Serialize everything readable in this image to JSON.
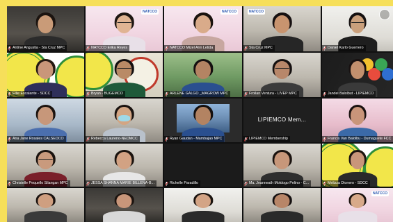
{
  "participants": [
    {
      "name": "Antine Angustia - Sta Cruz MPC",
      "scene": "office-dark",
      "skin": "#c99b78",
      "hair": "#1b1410",
      "shirt": "#2b2b2b"
    },
    {
      "name": "NATCCO Erika Reyes",
      "scene": "natcco-pink",
      "skin": "#e0b493",
      "hair": "#1e1612",
      "shirt": "#e8e0e8",
      "glasses": true
    },
    {
      "name": "NATCCO Mizel Ann Letida",
      "scene": "natcco-pink",
      "skin": "#d9ab8a",
      "hair": "#1a120e",
      "shirt": "#c7a7a0"
    },
    {
      "name": "Sta Cruz MPC",
      "scene": "office-light",
      "skin": "#c8946f",
      "hair": "#161010",
      "shirt": "#262626",
      "logo": "NATCCO"
    },
    {
      "name": "Daniel Karlo Guerrero",
      "scene": "office-white",
      "skin": "#caa07c",
      "hair": "#141010",
      "shirt": "#1e1e1e",
      "glasses": true
    },
    {
      "name": "Ellie Escalante - SDCC",
      "scene": "seal-bg",
      "skin": "#c9967a",
      "hair": "#241812",
      "shirt": "#2f2f5a"
    },
    {
      "name": "Bryan - BUGEMCO",
      "scene": "green-logo",
      "skin": "#b98a66",
      "hair": "#131010",
      "shirt": "#1f5a3a",
      "glasses": true
    },
    {
      "name": "ARLENE GALGO _MAGROW MPC",
      "scene": "outdoor",
      "skin": "#b48463",
      "hair": "#141010",
      "shirt": "#2a4f8f"
    },
    {
      "name": "Froilan Ventura - LIVEP MPC",
      "scene": "office-light",
      "skin": "#b8876a",
      "hair": "#151010",
      "shirt": "#3b3b3b",
      "glasses": true
    },
    {
      "name": "Jandel Balolbut - LIPIEMCO",
      "scene": "colorful",
      "skin": "#c2906e",
      "hair": "#171111",
      "shirt": "#3a3a3a"
    },
    {
      "name": "Ana Jane Rosales CALSEDCO",
      "scene": "office-blue",
      "skin": "#c7977a",
      "hair": "#1b130f",
      "shirt": "#4b6fae"
    },
    {
      "name": "Rebecca Laureno-NEDMCC",
      "scene": "office-light",
      "skin": "#d3a583",
      "hair": "#1a1310",
      "shirt": "#b9c1cb",
      "mask": true
    },
    {
      "name": "Ryan Gaudan - Mambajao MPC",
      "scene": "group-photo",
      "skin": "#b38362",
      "hair": "#141010",
      "shirt": "#2a4f8f"
    },
    {
      "name": "LIPIEMCO Membership",
      "scene": "name-only",
      "label": "LIPIEMCO  Mem..."
    },
    {
      "name": "Francis Van Balolbu - Dumaguete FCC",
      "scene": "pink-room",
      "skin": "#c9957a",
      "hair": "#1a1210",
      "shirt": "#3b6aa8"
    },
    {
      "name": "Christelle Pequello Silangan MPC",
      "scene": "office-light",
      "skin": "#c99a7d",
      "hair": "#1a130f",
      "shirt": "#7a1f2a",
      "glasses": true
    },
    {
      "name": "JESSA SHANNA MARIE BILLENA-B...",
      "scene": "office-light",
      "skin": "#d2a283",
      "hair": "#1b140f",
      "shirt": "#e7e7e7"
    },
    {
      "name": "Richelle Paradillo",
      "scene": "dark",
      "skin": "",
      "hair": "",
      "shirt": ""
    },
    {
      "name": "Ma. Jeanneath Moldogo Pelino - C...",
      "scene": "office-light",
      "skin": "#c7977a",
      "hair": "#1a130f",
      "shirt": "#2e2e2e"
    },
    {
      "name": "Melizza Dionero - SDCC",
      "scene": "seal-bg",
      "skin": "#c9967a",
      "hair": "#1c140f",
      "shirt": "#2a2a2a"
    },
    {
      "name": "",
      "scene": "office-light",
      "skin": "#cf9f80",
      "hair": "#1a1310",
      "shirt": "#3a3a3a"
    },
    {
      "name": "",
      "scene": "office-dark",
      "skin": "#c8967a",
      "hair": "#1c1410",
      "shirt": "#d8d8d8"
    },
    {
      "name": "",
      "scene": "office-white",
      "skin": "#d3a485",
      "hair": "#1b140f",
      "shirt": "#2a2a2a"
    },
    {
      "name": "",
      "scene": "office-light",
      "skin": "#b88668",
      "hair": "#151010",
      "shirt": "#2a2a2a"
    },
    {
      "name": "",
      "scene": "natcco-pink",
      "skin": "#d8aa8a",
      "hair": "#1a120e",
      "shirt": "#e8e0e8"
    }
  ],
  "logo_text": "NATCCO",
  "colors": {
    "frame": "#f6df5a",
    "grid": "#111111",
    "muted_mic": "#e33b3b"
  }
}
